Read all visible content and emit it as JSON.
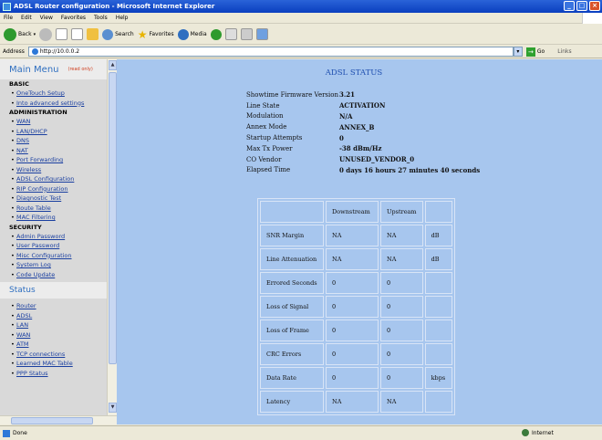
{
  "window": {
    "title": "ADSL Router configuration - Microsoft Internet Explorer"
  },
  "menubar": [
    "File",
    "Edit",
    "View",
    "Favorites",
    "Tools",
    "Help"
  ],
  "toolbar": {
    "back": "Back",
    "search": "Search",
    "favorites": "Favorites",
    "media": "Media"
  },
  "address": {
    "label": "Address",
    "url": "http://10.0.0.2",
    "go": "Go",
    "links": "Links"
  },
  "sidebar": {
    "title": "Main Menu",
    "caption": "(read only)",
    "basic_label": "BASIC",
    "basic": [
      "OneTouch Setup",
      "Into advanced settings"
    ],
    "admin_label": "ADMINISTRATION",
    "admin": [
      "WAN",
      "LAN/DHCP",
      "DNS",
      "NAT",
      "Port Forwarding",
      "Wireless",
      "ADSL Configuration",
      "RIP Configuration",
      "Diagnostic Test",
      "Route Table",
      "MAC Filtering"
    ],
    "security_label": "SECURITY",
    "security": [
      "Admin Password",
      "User Password",
      "Misc Configuration",
      "System Log",
      "Code Update"
    ],
    "status_label": "Status",
    "status": [
      "Router",
      "ADSL",
      "LAN",
      "WAN",
      "ATM",
      "TCP connections",
      "Learned MAC Table",
      "PPP Status"
    ]
  },
  "page": {
    "title": "ADSL STATUS",
    "info": [
      {
        "label": "Showtime Firmware Version",
        "value": "3.21"
      },
      {
        "label": "Line State",
        "value": "ACTIVATION"
      },
      {
        "label": "Modulation",
        "value": "N/A"
      },
      {
        "label": "Annex Mode",
        "value": "ANNEX_B"
      },
      {
        "label": "Startup Attempts",
        "value": "0"
      },
      {
        "label": "Max Tx Power",
        "value": "-38 dBm/Hz"
      },
      {
        "label": "CO Vendor",
        "value": "UNUSED_VENDOR_0"
      },
      {
        "label": "Elapsed Time",
        "value": "0 days 16 hours 27 minutes 40 seconds"
      }
    ],
    "table": {
      "headers": [
        "",
        "Downstream",
        "Upstream",
        ""
      ],
      "rows": [
        [
          "SNR Margin",
          "NA",
          "NA",
          "dB"
        ],
        [
          "Line Attenuation",
          "NA",
          "NA",
          "dB"
        ],
        [
          "Errored Seconds",
          "0",
          "0",
          ""
        ],
        [
          "Loss of Signal",
          "0",
          "0",
          ""
        ],
        [
          "Loss of Frame",
          "0",
          "0",
          ""
        ],
        [
          "CRC Errors",
          "0",
          "0",
          ""
        ],
        [
          "Data Rate",
          "0",
          "0",
          "kbps"
        ],
        [
          "Latency",
          "NA",
          "NA",
          ""
        ]
      ]
    }
  },
  "statusbar": {
    "left": "Done",
    "zone": "Internet"
  }
}
